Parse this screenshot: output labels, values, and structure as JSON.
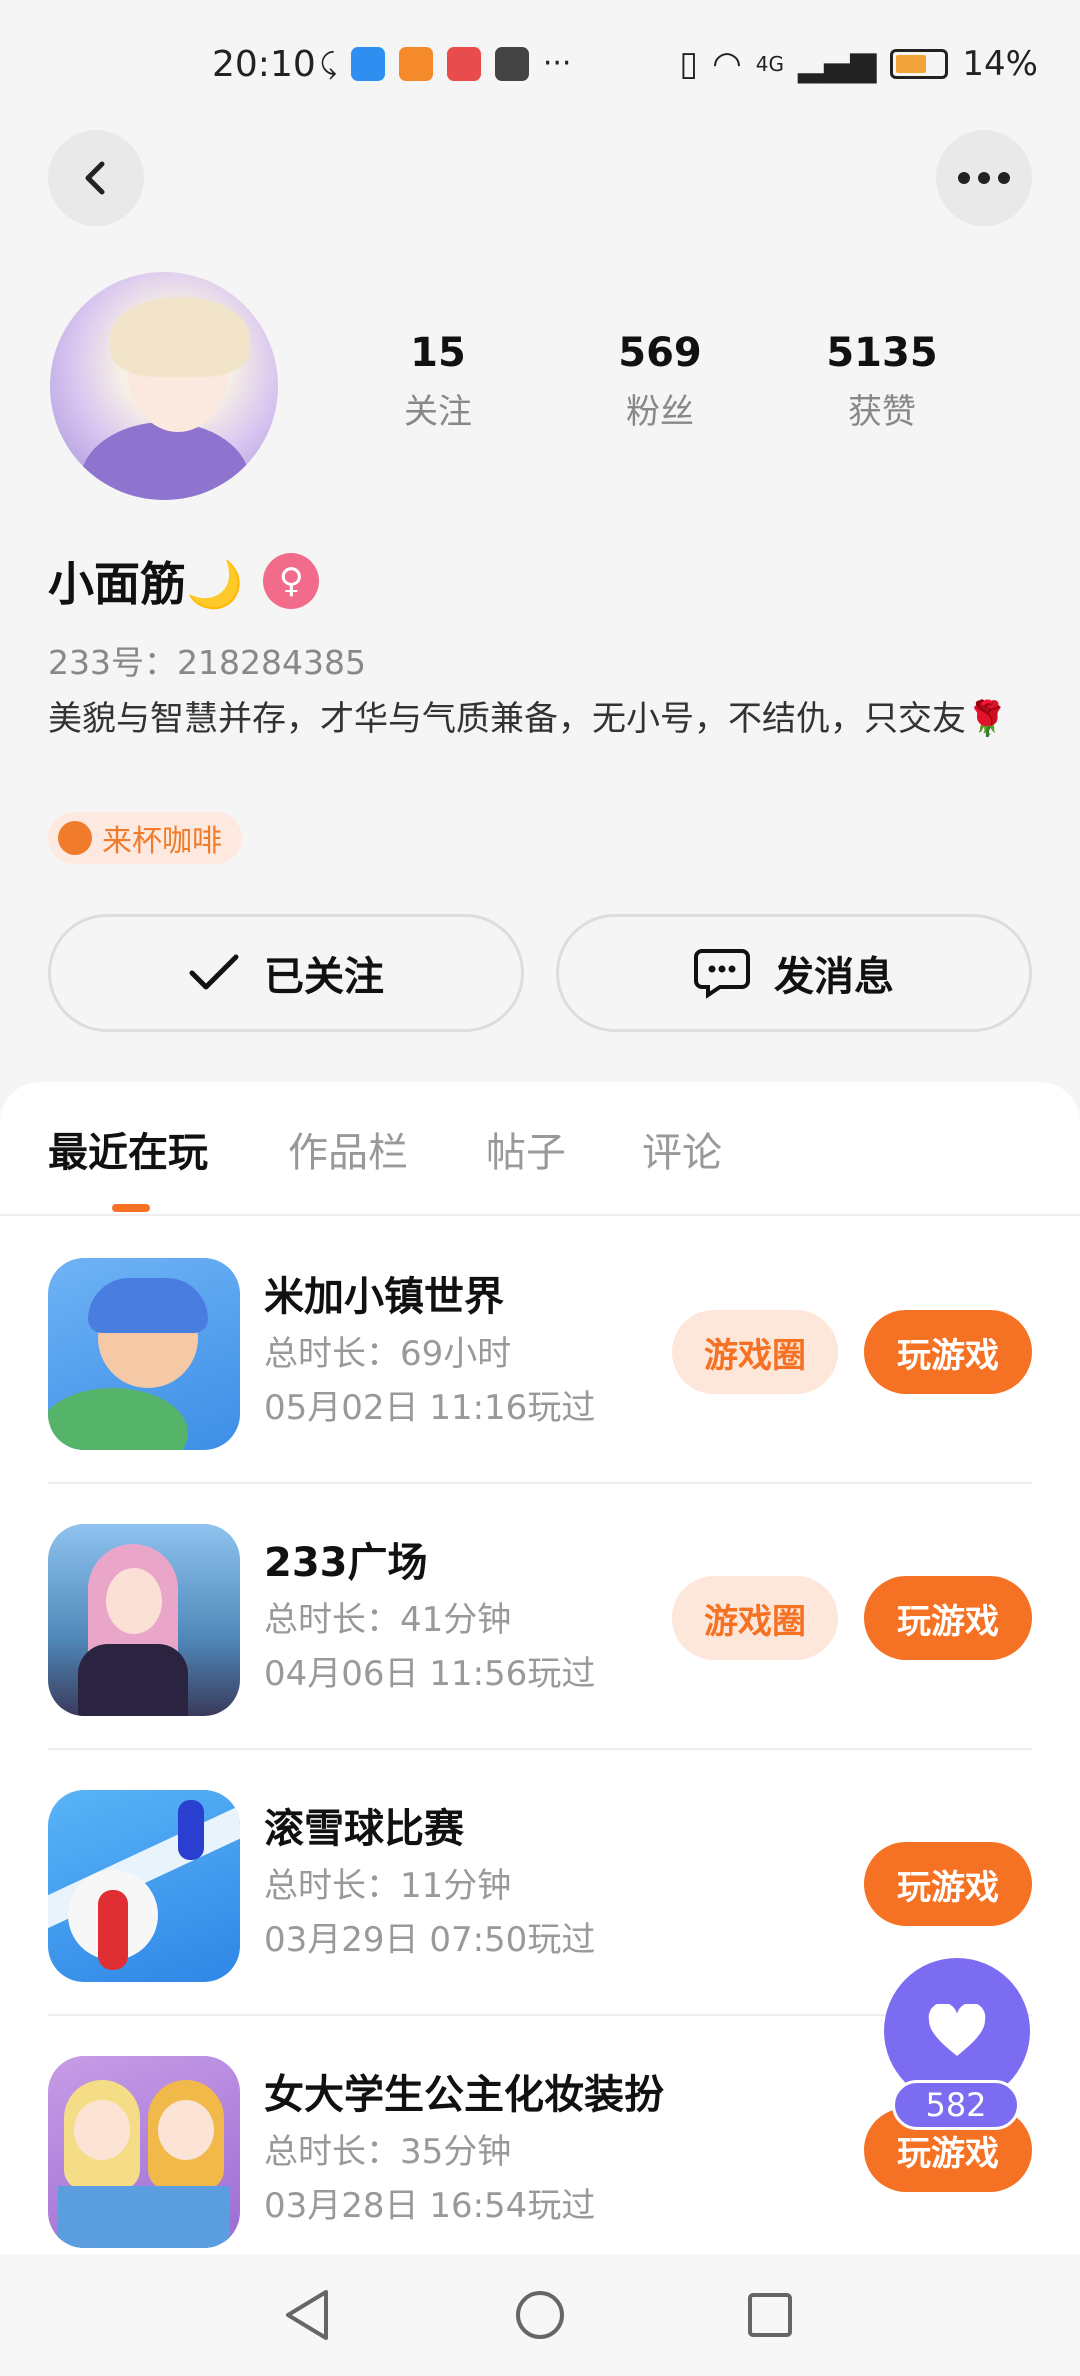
{
  "status_bar": {
    "time": "20:10",
    "battery": "14%",
    "network": "4G"
  },
  "header": {
    "back_icon": "back-arrow-icon",
    "more_icon": "more-dots-icon"
  },
  "profile": {
    "stats": [
      {
        "value": "15",
        "label": "关注"
      },
      {
        "value": "569",
        "label": "粉丝"
      },
      {
        "value": "5135",
        "label": "获赞"
      }
    ],
    "name": "小面筋🌙",
    "gender_symbol": "♀",
    "uid": "233号：218284385",
    "bio": "美貌与智慧并存，才华与气质兼备，无小号，不结仇，只交友🌹",
    "badge": "来杯咖啡"
  },
  "actions": {
    "follow_label": "已关注",
    "message_label": "发消息"
  },
  "tabs": [
    "最近在玩",
    "作品栏",
    "帖子",
    "评论"
  ],
  "games": [
    {
      "title": "米加小镇世界",
      "duration": "总时长：69小时",
      "played": "05月02日 11:16玩过",
      "circle": "游戏圈",
      "play": "玩游戏"
    },
    {
      "title": "233广场",
      "duration": "总时长：41分钟",
      "played": "04月06日 11:56玩过",
      "circle": "游戏圈",
      "play": "玩游戏"
    },
    {
      "title": "滚雪球比赛",
      "duration": "总时长：11分钟",
      "played": "03月29日 07:50玩过",
      "play": "玩游戏"
    },
    {
      "title": "女大学生公主化妆装扮",
      "duration": "总时长：35分钟",
      "played": "03月28日 16:54玩过",
      "play": "玩游戏"
    }
  ],
  "likes": {
    "count": "582"
  },
  "colors": {
    "accent": "#f57224",
    "like": "#7c6cf1",
    "gender": "#f26b8a"
  }
}
